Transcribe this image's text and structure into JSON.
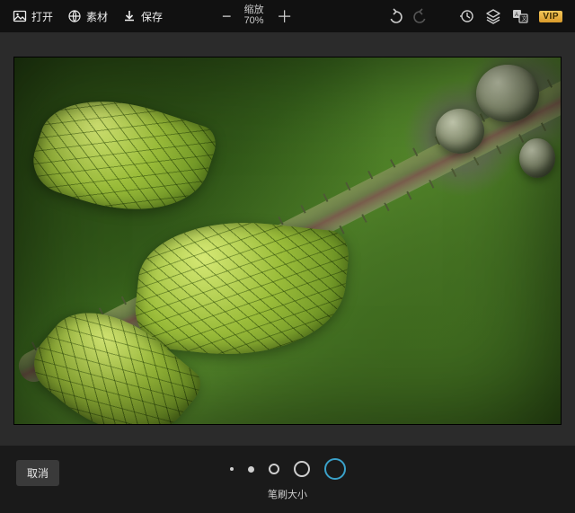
{
  "toolbar": {
    "open_label": "打开",
    "assets_label": "素材",
    "save_label": "保存"
  },
  "zoom": {
    "title": "缩放",
    "value": "70%"
  },
  "vip": {
    "label": "VIP"
  },
  "bottom": {
    "cancel_label": "取消",
    "brush_label": "笔刷大小"
  }
}
